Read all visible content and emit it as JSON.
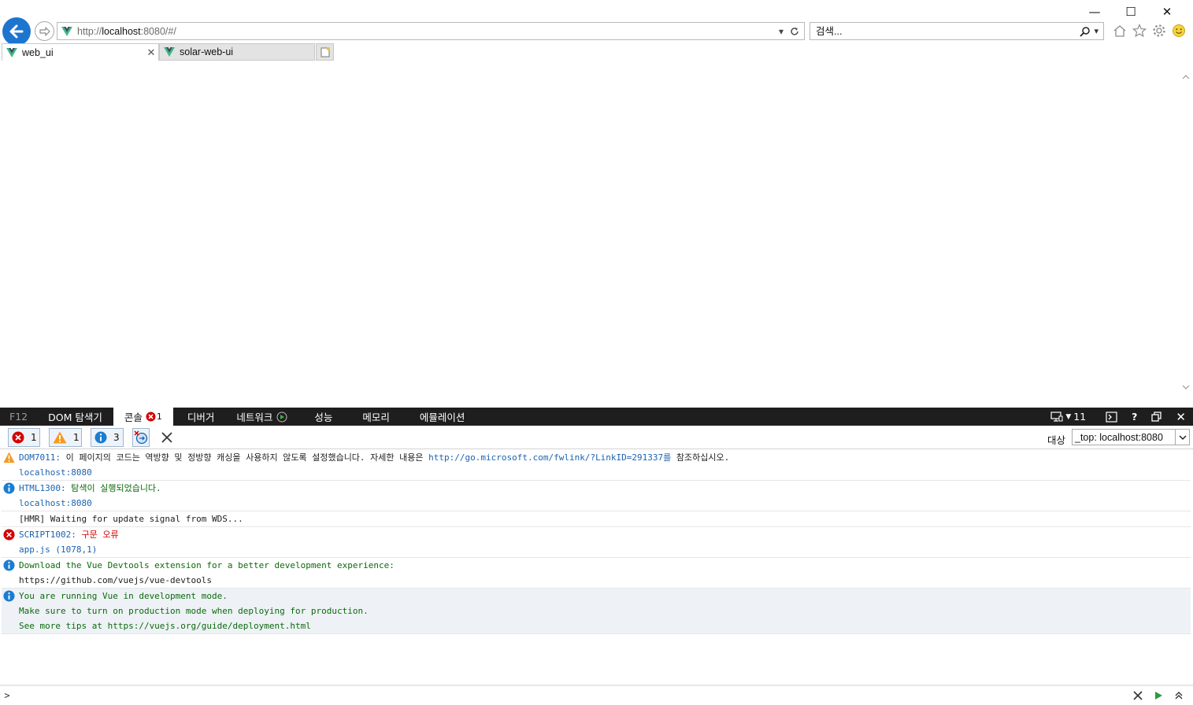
{
  "browser": {
    "address_prefix": "http://",
    "address_host": "localhost",
    "address_rest": ":8080/#/",
    "search_placeholder": "검색...",
    "tabs": [
      {
        "label": "web_ui",
        "active": true
      },
      {
        "label": "solar-web-ui",
        "active": false
      }
    ]
  },
  "devtools": {
    "f12_label": "F12",
    "tabs": [
      {
        "label": "DOM 탐색기"
      },
      {
        "label": "콘솔",
        "error_count": "1"
      },
      {
        "label": "디버거"
      },
      {
        "label": "네트워크"
      },
      {
        "label": "성능"
      },
      {
        "label": "메모리"
      },
      {
        "label": "에뮬레이션"
      }
    ],
    "doc_mode": "11",
    "filters": {
      "errors": "1",
      "warnings": "1",
      "info": "3"
    },
    "target_label": "대상",
    "target_value": "_top: localhost:8080",
    "messages": [
      {
        "level": "warning",
        "code": "DOM7011",
        "sep": ":",
        "text": " 이 페이지의 코드는 역방향 및 정방향 캐싱을 사용하지 않도록 설정했습니다. 자세한 내용은 ",
        "link": "http://go.microsoft.com/fwlink/?LinkID=291337",
        "link_suffix": "를",
        "text_after": " 참조하십시오.",
        "source": "localhost:8080"
      },
      {
        "level": "info",
        "code": "HTML1300",
        "sep": ":",
        "text": " 탐색이 실행되었습니다.",
        "source": "localhost:8080"
      },
      {
        "level": "log",
        "text": "[HMR] Waiting for update signal from WDS..."
      },
      {
        "level": "error",
        "code": "SCRIPT1002",
        "sep": ":",
        "text": " 구문 오류",
        "source": "app.js (1078,1)"
      },
      {
        "level": "info",
        "lines": [
          "Download the Vue Devtools extension for a better development experience:",
          "https://github.com/vuejs/vue-devtools"
        ]
      },
      {
        "level": "info",
        "lines": [
          "You are running Vue in development mode.",
          "Make sure to turn on production mode when deploying for production.",
          "See more tips at https://vuejs.org/guide/deployment.html"
        ]
      }
    ],
    "prompt": ">"
  },
  "colors": {
    "back_button": "#1d75d0",
    "vue_green": "#41b883",
    "vue_dark": "#35495e",
    "error_red": "#d40000",
    "info_blue": "#1a7dd1",
    "warning_orange": "#f39a1e",
    "devtools_bar": "#1e1e1e"
  }
}
